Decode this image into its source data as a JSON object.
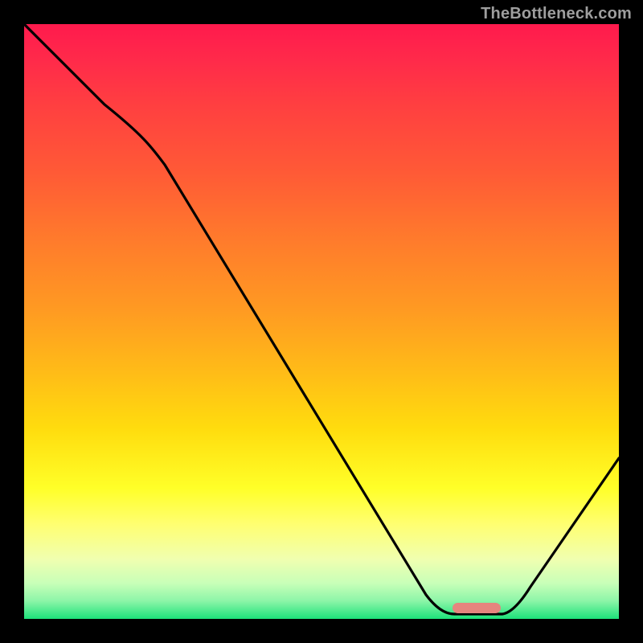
{
  "watermark": "TheBottleneck.com",
  "colors": {
    "curve": "#000000",
    "marker": "#e6857e",
    "gradient_top": "#ff1a4d",
    "gradient_bottom": "#1de27a"
  },
  "chart_data": {
    "type": "line",
    "title": "",
    "xlabel": "",
    "ylabel": "",
    "xlim": [
      0,
      100
    ],
    "ylim": [
      0,
      100
    ],
    "note": "No axis ticks or labels are rendered; values are estimated from pixel positions on a 0–100 normalized grid (x left→right, y bottom→top).",
    "series": [
      {
        "name": "curve",
        "x": [
          0,
          8,
          18,
          24,
          40,
          55,
          68,
          72,
          80,
          82,
          100
        ],
        "y": [
          100,
          93,
          83,
          76,
          50,
          26,
          4,
          1,
          1,
          2,
          27
        ]
      }
    ],
    "annotations": [
      {
        "name": "flat-minimum-marker",
        "shape": "pill",
        "x_start": 72,
        "x_end": 80,
        "y": 1
      }
    ]
  }
}
